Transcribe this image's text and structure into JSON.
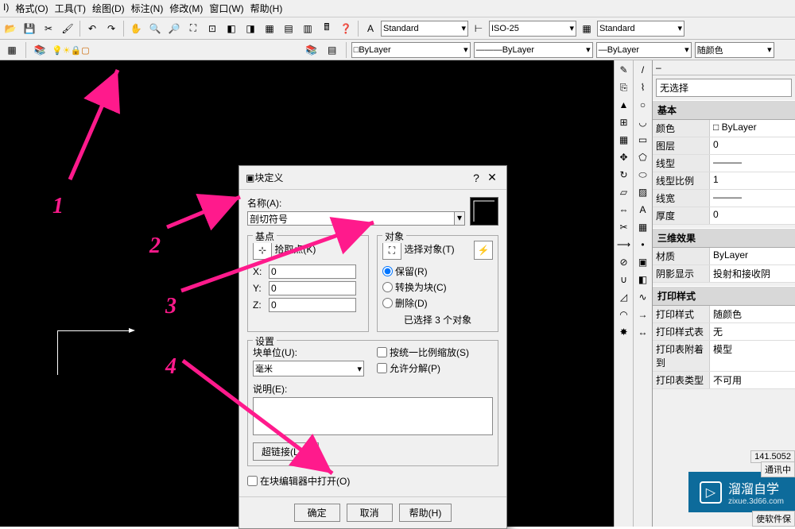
{
  "menu": {
    "items": [
      "I)",
      "格式(O)",
      "工具(T)",
      "绘图(D)",
      "标注(N)",
      "修改(M)",
      "窗口(W)",
      "帮助(H)"
    ]
  },
  "toolbar2": {
    "style1": "Standard",
    "style2": "ISO-25",
    "style3": "Standard"
  },
  "layerbar": {
    "layer": "ByLayer",
    "color": "ByLayer",
    "linetype": "ByLayer",
    "lineweight": "随颜色"
  },
  "dialog": {
    "title": "块定义",
    "name_label": "名称(A):",
    "name_value": "剖切符号",
    "base_group": "基点",
    "pick_point": "拾取点(K)",
    "x_label": "X:",
    "x_val": "0",
    "y_label": "Y:",
    "y_val": "0",
    "z_label": "Z:",
    "z_val": "0",
    "obj_group": "对象",
    "select_obj": "选择对象(T)",
    "radio_keep": "保留(R)",
    "radio_convert": "转换为块(C)",
    "radio_delete": "删除(D)",
    "selected_info": "已选择 3 个对象",
    "settings_group": "设置",
    "unit_label": "块单位(U):",
    "unit_value": "毫米",
    "scale_check": "按统一比例缩放(S)",
    "explode_check": "允许分解(P)",
    "desc_label": "说明(E):",
    "hyperlink_btn": "超链接(L)...",
    "open_editor_check": "在块编辑器中打开(O)",
    "ok": "确定",
    "cancel": "取消",
    "help": "帮助(H)"
  },
  "properties": {
    "header": "无选择",
    "groups": [
      {
        "title": "基本",
        "rows": [
          {
            "label": "颜色",
            "value": "□ ByLayer"
          },
          {
            "label": "图层",
            "value": "0"
          },
          {
            "label": "线型",
            "value": "———"
          },
          {
            "label": "线型比例",
            "value": "1"
          },
          {
            "label": "线宽",
            "value": "———"
          },
          {
            "label": "厚度",
            "value": "0"
          }
        ]
      },
      {
        "title": "三维效果",
        "rows": [
          {
            "label": "材质",
            "value": "ByLayer"
          },
          {
            "label": "阴影显示",
            "value": "投射和接收阴"
          }
        ]
      },
      {
        "title": "打印样式",
        "rows": [
          {
            "label": "打印样式",
            "value": "随颜色"
          },
          {
            "label": "打印样式表",
            "value": "无"
          },
          {
            "label": "打印表附着到",
            "value": "模型"
          },
          {
            "label": "打印表类型",
            "value": "不可用"
          }
        ]
      }
    ]
  },
  "annotations": {
    "n1": "1",
    "n2": "2",
    "n3": "3",
    "n4": "4"
  },
  "watermark": {
    "title": "溜溜自学",
    "url": "zixue.3d66.com"
  },
  "status": {
    "coord": "141.5052",
    "comm": "通讯中",
    "soft": "使软件保"
  }
}
